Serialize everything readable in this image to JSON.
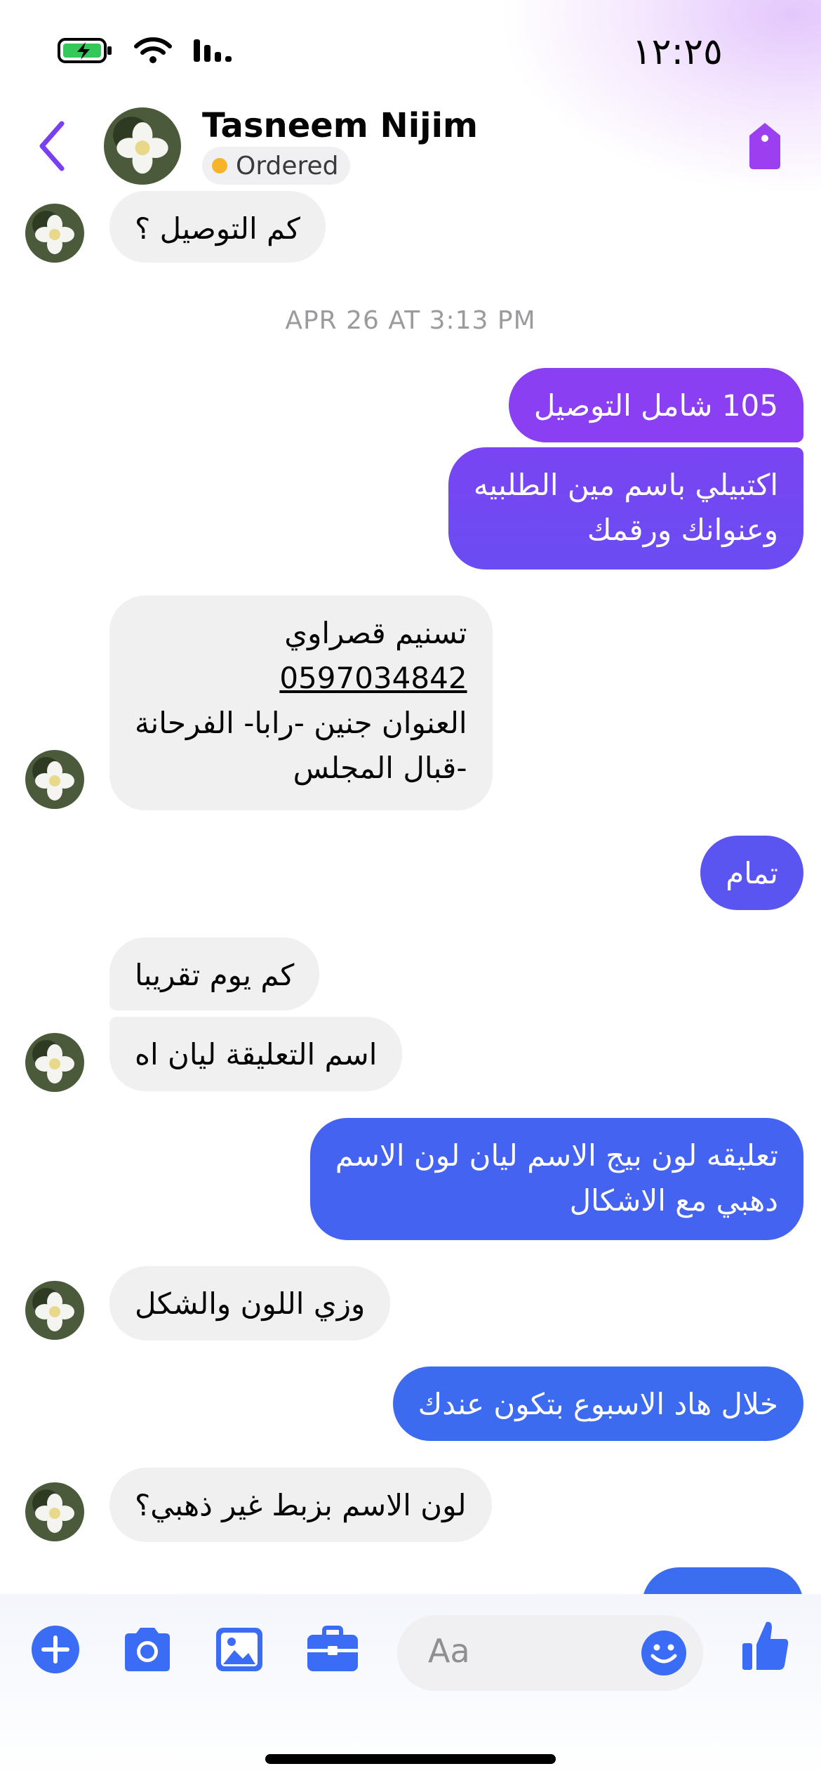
{
  "status": {
    "time": "١٢:٢٥"
  },
  "header": {
    "name": "Tasneem Nijim",
    "badge": "Ordered"
  },
  "messages": {
    "m1": "كم التوصيل ؟",
    "timestamp": "APR 26 AT 3:13 PM",
    "m2": "105 شامل التوصيل",
    "m3_l1": "اكتبيلي باسم مين الطلبيه",
    "m3_l2": "وعنوانك ورقمك",
    "m4_l1": "تسنيم قصراوي",
    "m4_l2": "0597034842",
    "m4_l3": "العنوان جنين -رابا- الفرحانة",
    "m4_l4": "-قبال المجلس",
    "m5": "تمام",
    "m6": "كم يوم تقريبا",
    "m7": "اسم التعليقة ليان اه",
    "m8_l1": "تعليقه لون بيج الاسم ليان لون الاسم",
    "m8_l2": "دهبي مع الاشكال",
    "m9": "وزي اللون والشكل",
    "m10": "خلال هاد الاسبوع بتكون عندك",
    "m11": "لون الاسم بزبط غير ذهبي؟",
    "m12": "...."
  },
  "composer": {
    "placeholder": "Aa"
  },
  "colors": {
    "accent": "#7b3ff2",
    "incoming_bubble": "#f0f0f0",
    "outgoing_top": "#8a3ff3",
    "outgoing_mid": "#6a4cf2",
    "outgoing_bottom": "#3b6df0",
    "icon_blue": "#3b6cf5",
    "badge_dot": "#f5b42a"
  }
}
